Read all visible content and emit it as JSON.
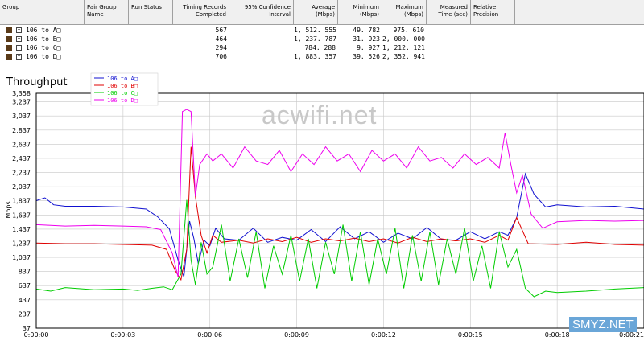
{
  "table": {
    "headers": [
      "Group",
      "Pair Group\nName",
      "Run Status",
      "Timing Records\nCompleted",
      "95% Confidence\nInterval",
      "Average\n(Mbps)",
      "Minimum\n(Mbps)",
      "Maximum\n(Mbps)",
      "Measured\nTime (sec)",
      "Relative\nPrecision"
    ],
    "rows": [
      {
        "name": "106 to A□",
        "records": "567",
        "average": "1, 512. 555",
        "minimum": "49. 782",
        "maximum": "975. 610"
      },
      {
        "name": "106 to B□",
        "records": "464",
        "average": "1, 237. 787",
        "minimum": "31. 923",
        "maximum": "2, 000. 000"
      },
      {
        "name": "106 to C□",
        "records": "294",
        "average": "784. 288",
        "minimum": "9. 927",
        "maximum": "1, 212. 121"
      },
      {
        "name": "106 to D□",
        "records": "706",
        "average": "1, 883. 357",
        "minimum": "39. 526",
        "maximum": "2, 352. 941"
      }
    ]
  },
  "watermarks": {
    "main": "acwifi.net",
    "corner": "SMYZ.NET"
  },
  "chart_data": {
    "type": "line",
    "title": "Throughput",
    "xlabel": "",
    "ylabel": "Mbps",
    "ylim": [
      37,
      3358
    ],
    "xlim": [
      0,
      21
    ],
    "y_ticks": [
      "37",
      "237",
      "437",
      "637",
      "837",
      "1,037",
      "1,237",
      "1,437",
      "1,637",
      "1,837",
      "2,037",
      "2,237",
      "2,437",
      "2,637",
      "2,837",
      "3,037",
      "3,237",
      "3,358"
    ],
    "x_ticks": [
      "0:00:00",
      "0:00:03",
      "0:00:06",
      "0:00:09",
      "0:00:12",
      "0:00:15",
      "0:00:18",
      "0:00:21"
    ],
    "legend_position": "top-left",
    "series": [
      {
        "name": "106 to A□",
        "color": "#1010d0",
        "values": [
          [
            0,
            1840
          ],
          [
            0.3,
            1880
          ],
          [
            0.6,
            1780
          ],
          [
            1,
            1760
          ],
          [
            2,
            1760
          ],
          [
            3,
            1750
          ],
          [
            3.8,
            1720
          ],
          [
            4.2,
            1610
          ],
          [
            4.6,
            1440
          ],
          [
            4.9,
            1000
          ],
          [
            5.1,
            760
          ],
          [
            5.3,
            1550
          ],
          [
            5.45,
            1300
          ],
          [
            5.6,
            950
          ],
          [
            5.8,
            1280
          ],
          [
            6,
            1200
          ],
          [
            6.2,
            1450
          ],
          [
            6.5,
            1300
          ],
          [
            7,
            1280
          ],
          [
            7.5,
            1450
          ],
          [
            8,
            1250
          ],
          [
            8.5,
            1320
          ],
          [
            9,
            1280
          ],
          [
            9.5,
            1430
          ],
          [
            10,
            1260
          ],
          [
            10.5,
            1470
          ],
          [
            11,
            1300
          ],
          [
            11.5,
            1400
          ],
          [
            12,
            1250
          ],
          [
            12.5,
            1380
          ],
          [
            13,
            1300
          ],
          [
            13.5,
            1460
          ],
          [
            14,
            1290
          ],
          [
            14.5,
            1280
          ],
          [
            15,
            1400
          ],
          [
            15.5,
            1300
          ],
          [
            16,
            1400
          ],
          [
            16.3,
            1350
          ],
          [
            16.6,
            1600
          ],
          [
            16.9,
            2220
          ],
          [
            17.2,
            1930
          ],
          [
            17.6,
            1750
          ],
          [
            18,
            1780
          ],
          [
            19,
            1750
          ],
          [
            20,
            1760
          ],
          [
            21,
            1720
          ]
        ]
      },
      {
        "name": "106 to B□",
        "color": "#e00000",
        "values": [
          [
            0,
            1240
          ],
          [
            1,
            1230
          ],
          [
            2,
            1230
          ],
          [
            3,
            1220
          ],
          [
            4,
            1210
          ],
          [
            4.5,
            1150
          ],
          [
            4.8,
            850
          ],
          [
            5,
            720
          ],
          [
            5.2,
            1150
          ],
          [
            5.35,
            2600
          ],
          [
            5.5,
            1900
          ],
          [
            5.7,
            1350
          ],
          [
            5.9,
            1100
          ],
          [
            6.1,
            1350
          ],
          [
            6.4,
            1250
          ],
          [
            7,
            1280
          ],
          [
            7.5,
            1240
          ],
          [
            8,
            1300
          ],
          [
            8.5,
            1260
          ],
          [
            9,
            1320
          ],
          [
            9.5,
            1250
          ],
          [
            10,
            1300
          ],
          [
            10.5,
            1270
          ],
          [
            11,
            1310
          ],
          [
            11.5,
            1260
          ],
          [
            12,
            1300
          ],
          [
            12.5,
            1240
          ],
          [
            13,
            1320
          ],
          [
            13.5,
            1260
          ],
          [
            14,
            1300
          ],
          [
            14.5,
            1270
          ],
          [
            15,
            1300
          ],
          [
            15.5,
            1250
          ],
          [
            16,
            1350
          ],
          [
            16.3,
            1280
          ],
          [
            16.6,
            1600
          ],
          [
            17,
            1230
          ],
          [
            18,
            1220
          ],
          [
            19,
            1250
          ],
          [
            20,
            1220
          ],
          [
            21,
            1210
          ]
        ]
      },
      {
        "name": "106 to C□",
        "color": "#00cc00",
        "values": [
          [
            0,
            590
          ],
          [
            0.5,
            560
          ],
          [
            1,
            610
          ],
          [
            2,
            580
          ],
          [
            3,
            590
          ],
          [
            3.5,
            570
          ],
          [
            4,
            600
          ],
          [
            4.4,
            620
          ],
          [
            4.7,
            580
          ],
          [
            5,
            800
          ],
          [
            5.2,
            1850
          ],
          [
            5.35,
            1000
          ],
          [
            5.5,
            650
          ],
          [
            5.7,
            1250
          ],
          [
            5.9,
            800
          ],
          [
            6.1,
            900
          ],
          [
            6.4,
            1500
          ],
          [
            6.7,
            700
          ],
          [
            7,
            1300
          ],
          [
            7.3,
            750
          ],
          [
            7.6,
            1400
          ],
          [
            7.9,
            600
          ],
          [
            8.2,
            1200
          ],
          [
            8.5,
            800
          ],
          [
            8.8,
            1350
          ],
          [
            9.1,
            700
          ],
          [
            9.4,
            1300
          ],
          [
            9.7,
            600
          ],
          [
            10,
            1250
          ],
          [
            10.3,
            800
          ],
          [
            10.6,
            1500
          ],
          [
            10.9,
            700
          ],
          [
            11.2,
            1400
          ],
          [
            11.5,
            650
          ],
          [
            11.8,
            1300
          ],
          [
            12.1,
            800
          ],
          [
            12.4,
            1450
          ],
          [
            12.7,
            600
          ],
          [
            13,
            1350
          ],
          [
            13.3,
            700
          ],
          [
            13.6,
            1400
          ],
          [
            13.9,
            650
          ],
          [
            14.2,
            1300
          ],
          [
            14.5,
            800
          ],
          [
            14.8,
            1450
          ],
          [
            15.1,
            700
          ],
          [
            15.4,
            1200
          ],
          [
            15.7,
            600
          ],
          [
            16,
            1400
          ],
          [
            16.3,
            900
          ],
          [
            16.6,
            1150
          ],
          [
            16.9,
            600
          ],
          [
            17.2,
            480
          ],
          [
            17.6,
            560
          ],
          [
            18,
            540
          ],
          [
            19,
            560
          ],
          [
            20,
            590
          ],
          [
            21,
            610
          ]
        ]
      },
      {
        "name": "106 to D□",
        "color": "#ee00ee",
        "values": [
          [
            0,
            1500
          ],
          [
            1,
            1480
          ],
          [
            2,
            1490
          ],
          [
            3,
            1480
          ],
          [
            3.8,
            1470
          ],
          [
            4.3,
            1430
          ],
          [
            4.7,
            1100
          ],
          [
            4.9,
            760
          ],
          [
            5.05,
            3100
          ],
          [
            5.2,
            3130
          ],
          [
            5.35,
            3100
          ],
          [
            5.5,
            1900
          ],
          [
            5.65,
            2350
          ],
          [
            5.9,
            2500
          ],
          [
            6.1,
            2400
          ],
          [
            6.4,
            2500
          ],
          [
            6.8,
            2300
          ],
          [
            7.2,
            2600
          ],
          [
            7.6,
            2400
          ],
          [
            8,
            2350
          ],
          [
            8.4,
            2550
          ],
          [
            8.8,
            2250
          ],
          [
            9.2,
            2500
          ],
          [
            9.6,
            2350
          ],
          [
            10,
            2600
          ],
          [
            10.4,
            2400
          ],
          [
            10.8,
            2500
          ],
          [
            11.2,
            2250
          ],
          [
            11.6,
            2550
          ],
          [
            12,
            2400
          ],
          [
            12.4,
            2500
          ],
          [
            12.8,
            2300
          ],
          [
            13.2,
            2600
          ],
          [
            13.6,
            2400
          ],
          [
            14,
            2450
          ],
          [
            14.4,
            2300
          ],
          [
            14.8,
            2500
          ],
          [
            15.2,
            2350
          ],
          [
            15.6,
            2450
          ],
          [
            16,
            2300
          ],
          [
            16.2,
            2800
          ],
          [
            16.4,
            2350
          ],
          [
            16.6,
            1950
          ],
          [
            16.8,
            2200
          ],
          [
            17.1,
            1650
          ],
          [
            17.5,
            1450
          ],
          [
            18,
            1540
          ],
          [
            19,
            1560
          ],
          [
            20,
            1550
          ],
          [
            21,
            1560
          ]
        ]
      }
    ]
  }
}
